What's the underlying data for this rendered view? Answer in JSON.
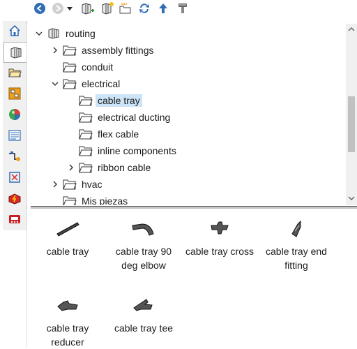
{
  "toolbar": {
    "icons": [
      "back-icon",
      "forward-icon",
      "history-dropdown-icon",
      "add-library-icon",
      "add-folder-icon",
      "new-folder-icon",
      "refresh-icon",
      "up-level-icon",
      "options-icon"
    ]
  },
  "side_tabs": [
    "home-icon",
    "design-library-icon",
    "file-explorer-icon",
    "view-palette-icon",
    "appearances-icon",
    "custom-properties-icon",
    "routing-library-icon",
    "electrical-icon",
    "toolbox-icon",
    "forum-icon"
  ],
  "tree": {
    "items": [
      {
        "label": "routing",
        "type": "library",
        "expanded": true
      },
      {
        "label": "assembly fittings",
        "type": "folder",
        "expanded": false
      },
      {
        "label": "conduit",
        "type": "folder"
      },
      {
        "label": "electrical",
        "type": "folder",
        "expanded": true
      },
      {
        "label": "cable tray",
        "type": "folder",
        "selected": true
      },
      {
        "label": "electrical ducting",
        "type": "folder"
      },
      {
        "label": "flex cable",
        "type": "folder"
      },
      {
        "label": "inline components",
        "type": "folder"
      },
      {
        "label": "ribbon cable",
        "type": "folder",
        "expanded": false
      },
      {
        "label": "hvac",
        "type": "folder",
        "expanded": false
      },
      {
        "label": "Mis piezas",
        "type": "folder"
      }
    ]
  },
  "gallery": {
    "items": [
      {
        "label_1": "cable tray",
        "label_2": ""
      },
      {
        "label_1": "cable tray 90",
        "label_2": "deg elbow"
      },
      {
        "label_1": "cable tray cross",
        "label_2": ""
      },
      {
        "label_1": "cable tray end",
        "label_2": "fitting"
      },
      {
        "label_1": "cable tray",
        "label_2": "reducer"
      },
      {
        "label_1": "cable tray tee",
        "label_2": ""
      }
    ]
  },
  "colors": {
    "selection": "#cce4f7",
    "tab_strip": "#f0f0f0"
  }
}
